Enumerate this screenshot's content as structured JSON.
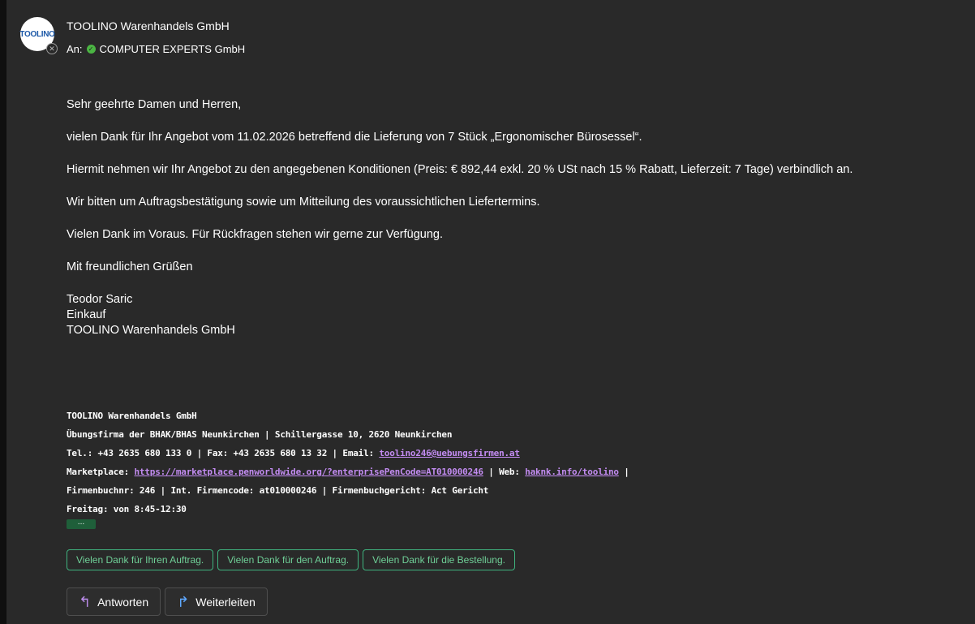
{
  "sender": {
    "avatar_text": "TOOLINO",
    "name": "TOOLINO Warenhandels GmbH"
  },
  "recipients": {
    "prefix": "An:",
    "name": "COMPUTER EXPERTS GmbH"
  },
  "body": {
    "greeting": "Sehr geehrte Damen und Herren,",
    "para1": "vielen Dank für Ihr Angebot vom 11.02.2026 betreffend die Lieferung von 7 Stück „Ergonomischer Bürosessel“.",
    "para2": "Hiermit nehmen wir Ihr Angebot zu den angegebenen Konditionen (Preis: € 892,44 exkl. 20 % USt nach 15 % Rabatt, Lieferzeit: 7 Tage) verbindlich an.",
    "para3": "Wir bitten um Auftragsbestätigung sowie um Mitteilung des voraussichtlichen Liefertermins.",
    "para4": "Vielen Dank im Voraus. Für Rückfragen stehen wir gerne zur Verfügung.",
    "closing": "Mit freundlichen Grüßen",
    "sig_name": "Teodor Saric",
    "sig_role": "Einkauf",
    "sig_company": "TOOLINO Warenhandels GmbH"
  },
  "footer": {
    "company": "TOOLINO Warenhandels GmbH",
    "line2": "Übungsfirma der BHAK/BHAS Neunkirchen | Schillergasse 10, 2620 Neunkirchen",
    "line3_prefix": "Tel.: +43 2635 680 133 0 | Fax: +43 2635 680 13 32 | Email: ",
    "email": "toolino246@uebungsfirmen.at",
    "line4_prefix": "Marketplace: ",
    "marketplace_url": "https://marketplace.penworldwide.org/?enterprisePenCode=AT010000246",
    "line4_mid": " | Web: ",
    "web_url": "haknk.info/toolino",
    "line4_suffix": " |",
    "line5": "Firmenbuchnr: 246 | Int. Firmencode: at010000246 | Firmenbuchgericht: Act Gericht",
    "line6": "Freitag: von 8:45-12:30",
    "ellipsis": "..."
  },
  "suggested_replies": [
    "Vielen Dank für Ihren Auftrag.",
    "Vielen Dank für den Auftrag.",
    "Vielen Dank für die Bestellung."
  ],
  "actions": {
    "reply": "Antworten",
    "forward": "Weiterleiten"
  }
}
